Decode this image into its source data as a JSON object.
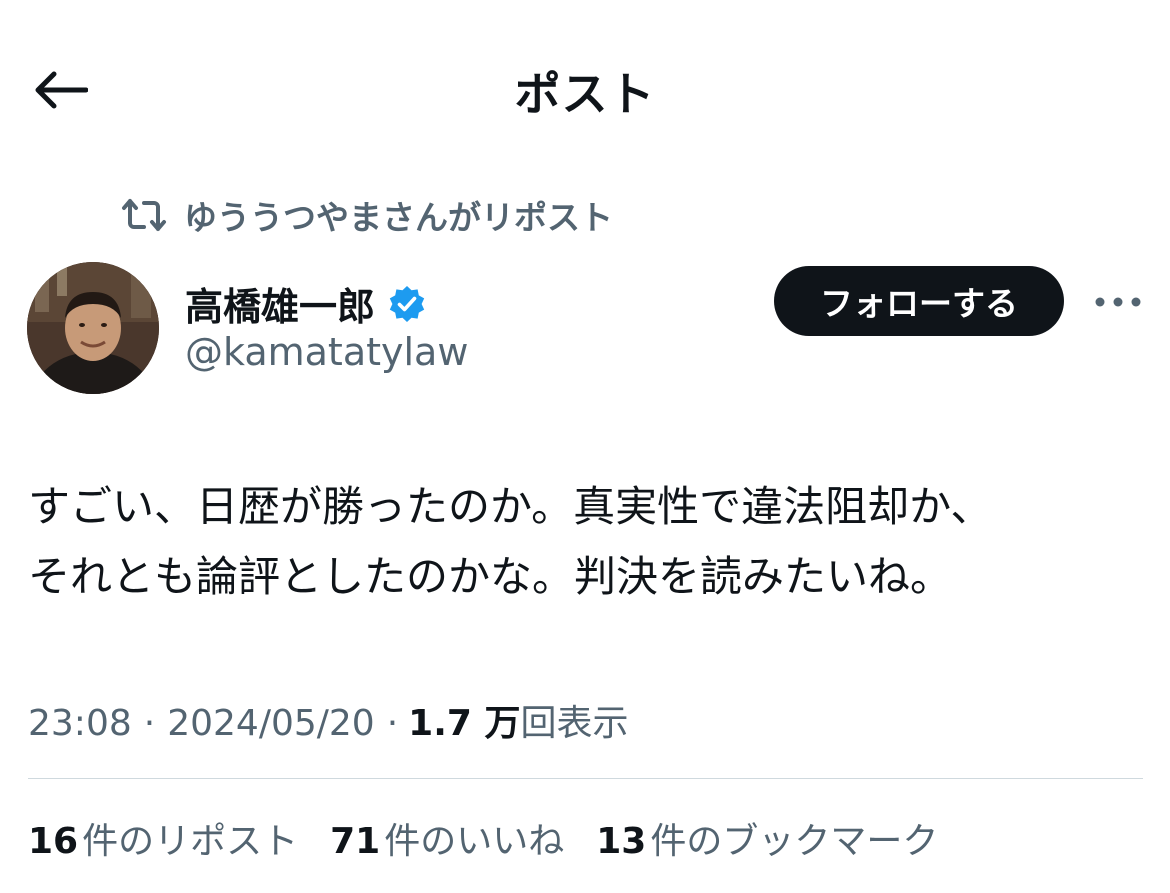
{
  "header": {
    "title": "ポスト",
    "back_icon": "arrow-left-icon"
  },
  "repost": {
    "icon": "repost-icon",
    "text": "ゆううつやまさんがリポスト"
  },
  "author": {
    "name": "高橋雄一郎",
    "handle": "@kamatatylaw",
    "verified_color": "#1d9bf0"
  },
  "actions": {
    "follow_label": "フォローする",
    "more_icon": "more-horizontal-icon"
  },
  "tweet": {
    "text": "すごい、日歴が勝ったのか。真実性で違法阻却か、\nそれとも論評としたのかな。判決を読みたいね。"
  },
  "meta": {
    "time": "23:08",
    "sep1": "·",
    "date": "2024/05/20",
    "sep2": "·",
    "views_count": "1.7 万",
    "views_label": "回表示"
  },
  "stats": [
    {
      "count": "16",
      "label": "件のリポスト"
    },
    {
      "count": "71",
      "label": "件のいいね"
    },
    {
      "count": "13",
      "label": "件のブックマーク"
    }
  ],
  "colors": {
    "text_primary": "#0f1419",
    "text_secondary": "#536471",
    "divider": "#cfd9de",
    "accent": "#1d9bf0"
  }
}
